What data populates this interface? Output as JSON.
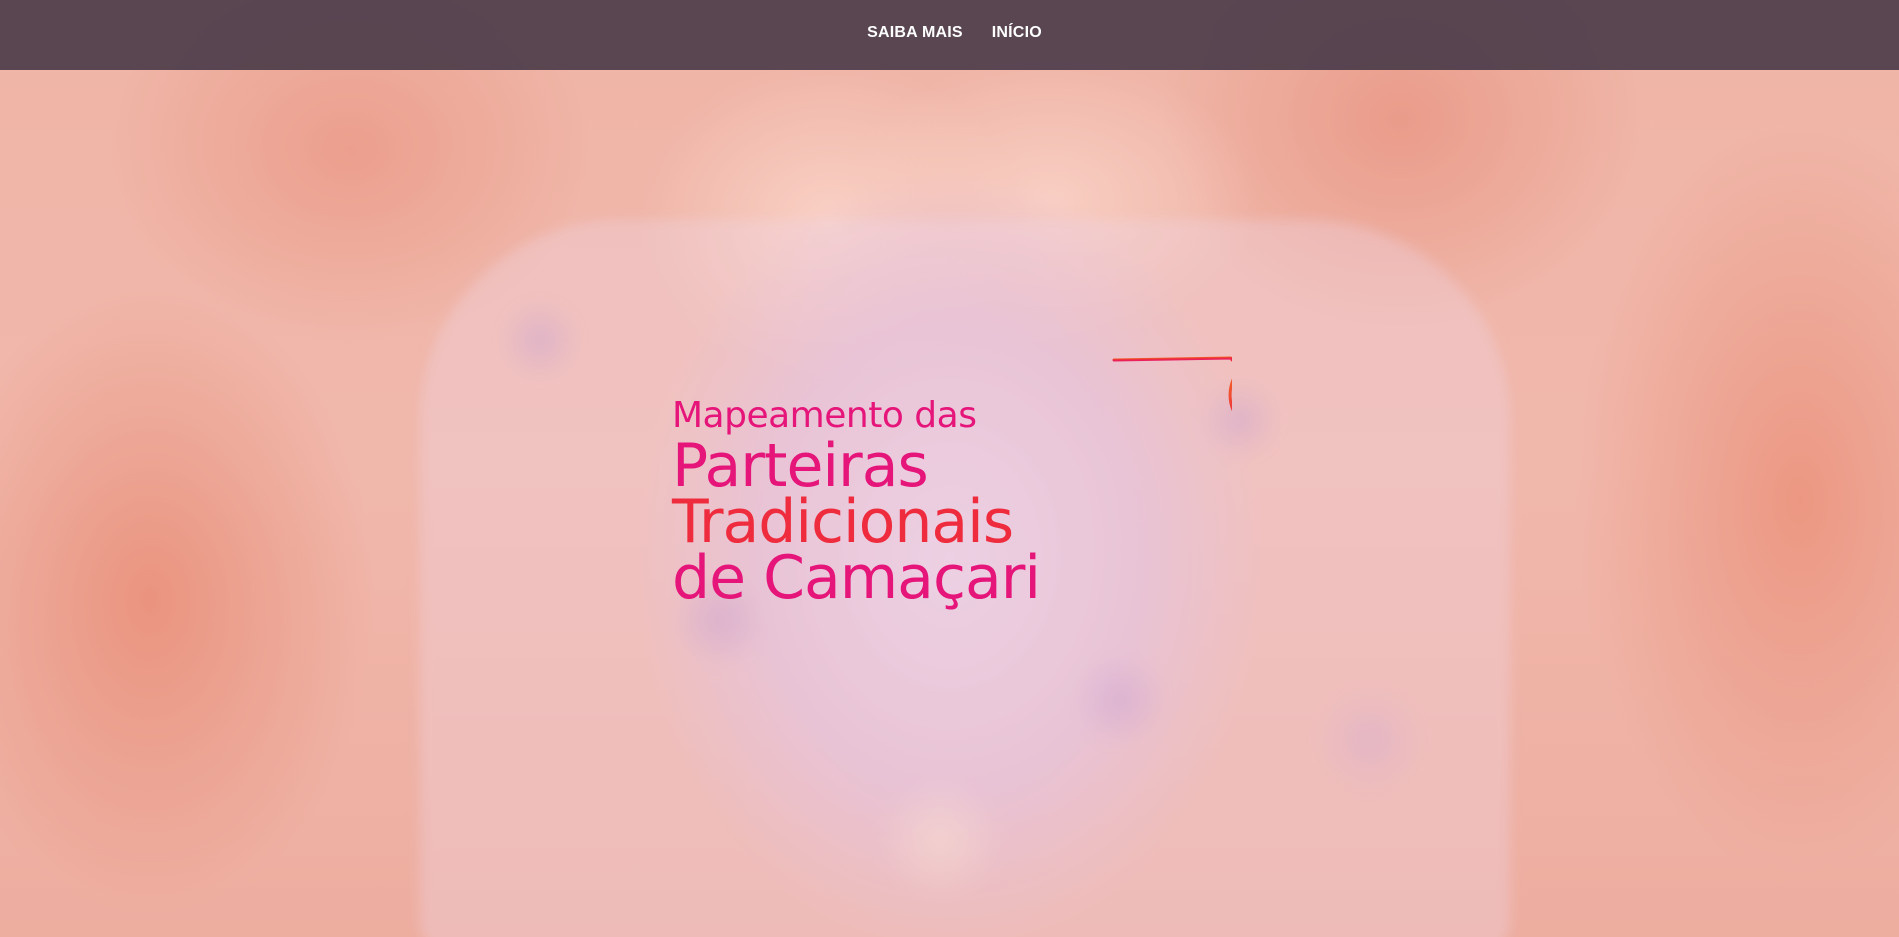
{
  "nav": {
    "items": [
      {
        "label": "SAIBA MAIS"
      },
      {
        "label": "INÍCIO"
      }
    ]
  },
  "logo": {
    "line1": "Mapeamento das",
    "line2": "Parteiras",
    "line3": "Tradicionais",
    "line4": "de Camaçari",
    "icon": "hummingbird-icon"
  },
  "colors": {
    "topbar": "#4a3c4a",
    "nav_text": "#ffffff",
    "magenta": "#e5157a",
    "red": "#ee2c3e",
    "orange": "#f47a1f"
  }
}
